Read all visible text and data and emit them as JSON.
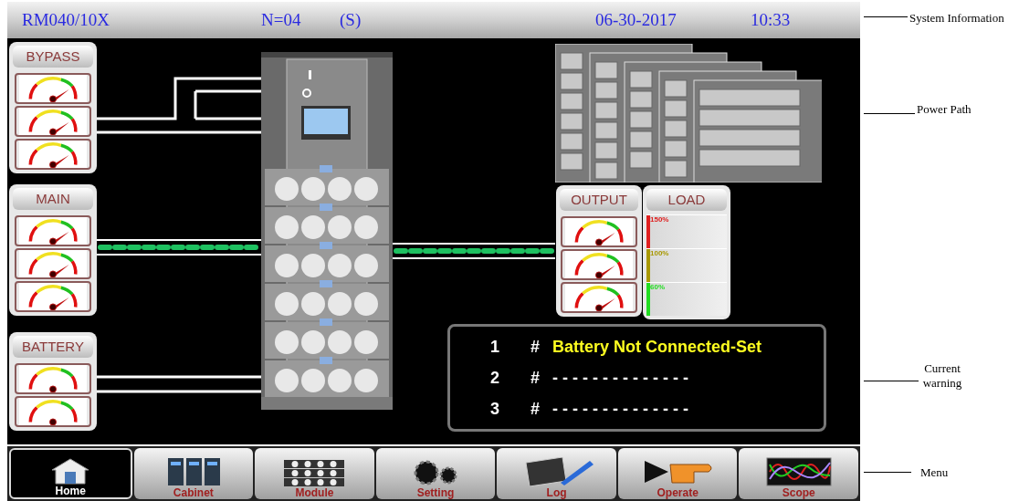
{
  "header": {
    "model": "RM040/10X",
    "units": "N=04",
    "mode": "(S)",
    "date": "06-30-2017",
    "time": "10:33"
  },
  "meter_groups": [
    {
      "label": "BYPASS",
      "gauges": [
        {
          "needle": true
        },
        {
          "needle": true
        },
        {
          "needle": true
        }
      ]
    },
    {
      "label": "MAIN",
      "gauges": [
        {
          "needle": true
        },
        {
          "needle": true
        },
        {
          "needle": true
        }
      ]
    },
    {
      "label": "BATTERY",
      "gauges": [
        {
          "needle": false
        },
        {
          "needle": false
        }
      ]
    },
    {
      "label": "OUTPUT",
      "gauges": [
        {
          "needle": true
        },
        {
          "needle": true
        },
        {
          "needle": true
        }
      ]
    }
  ],
  "load": {
    "label": "LOAD",
    "scale": [
      {
        "text": "150%",
        "color": "#e02020"
      },
      {
        "text": "100%",
        "color": "#a89800"
      },
      {
        "text": "60%",
        "color": "#22dd22"
      }
    ]
  },
  "power_flow": {
    "main": true,
    "output": true
  },
  "warnings": [
    {
      "number": "1",
      "hash": "#",
      "text": "Battery Not Connected-Set",
      "active": true
    },
    {
      "number": "2",
      "hash": "#",
      "text": "- - - - - - - - - - - - - -",
      "active": false
    },
    {
      "number": "3",
      "hash": "#",
      "text": "- - - - - - - - - - - - - -",
      "active": false
    }
  ],
  "menu": [
    {
      "label": "Home",
      "kind": "home",
      "selected": true
    },
    {
      "label": "Cabinet",
      "kind": "cabinet",
      "selected": false
    },
    {
      "label": "Module",
      "kind": "module",
      "selected": false
    },
    {
      "label": "Setting",
      "kind": "setting",
      "selected": false
    },
    {
      "label": "Log",
      "kind": "log",
      "selected": false
    },
    {
      "label": "Operate",
      "kind": "operate",
      "selected": false
    },
    {
      "label": "Scope",
      "kind": "scope",
      "selected": false
    }
  ],
  "annotations": [
    "System Information",
    "Power Path",
    "Current warning",
    "Menu"
  ]
}
